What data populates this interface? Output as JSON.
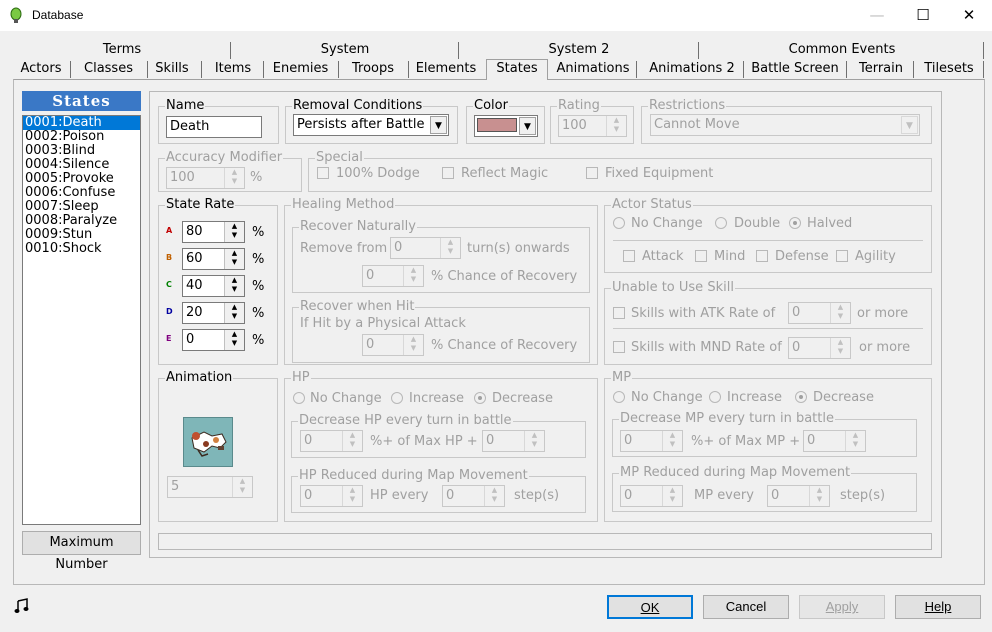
{
  "window": {
    "title": "Database",
    "minimize": "—",
    "maximize": "☐",
    "close": "✕"
  },
  "tabs": {
    "row1": [
      "Terms",
      "System",
      "System 2",
      "Common Events"
    ],
    "row2": [
      "Actors",
      "Classes",
      "Skills",
      "Items",
      "Enemies",
      "Troops",
      "Elements",
      "States",
      "Animations",
      "Animations 2",
      "Battle Screen",
      "Terrain",
      "Tilesets"
    ],
    "selected": "States"
  },
  "list": {
    "header": "States",
    "items": [
      "0001:Death",
      "0002:Poison",
      "0003:Blind",
      "0004:Silence",
      "0005:Provoke",
      "0006:Confuse",
      "0007:Sleep",
      "0008:Paralyze",
      "0009:Stun",
      "0010:Shock"
    ],
    "selected_index": 0,
    "max_button": "Maximum Number"
  },
  "name": {
    "label": "Name",
    "value": "Death"
  },
  "removal": {
    "label": "Removal Conditions",
    "value": "Persists after Battle"
  },
  "color": {
    "label": "Color",
    "swatch": "#c89090"
  },
  "rating": {
    "label": "Rating",
    "value": "100"
  },
  "restrictions": {
    "label": "Restrictions",
    "value": "Cannot Move"
  },
  "accuracy": {
    "label": "Accuracy Modifier",
    "value": "100",
    "unit": "%"
  },
  "special": {
    "label": "Special",
    "dodge": "100% Dodge",
    "reflect": "Reflect Magic",
    "fixed": "Fixed Equipment"
  },
  "state_rate": {
    "label": "State Rate",
    "rows": [
      {
        "letter": "A",
        "value": "80",
        "unit": "%",
        "color": "#c00000"
      },
      {
        "letter": "B",
        "value": "60",
        "unit": "%",
        "color": "#c06000"
      },
      {
        "letter": "C",
        "value": "40",
        "unit": "%",
        "color": "#008000"
      },
      {
        "letter": "D",
        "value": "20",
        "unit": "%",
        "color": "#0000a0"
      },
      {
        "letter": "E",
        "value": "0",
        "unit": "%",
        "color": "#800080"
      }
    ]
  },
  "healing": {
    "label": "Healing Method",
    "recover_naturally": {
      "label": "Recover Naturally",
      "remove_from": "Remove from",
      "turns_value": "0",
      "turns_suffix": "turn(s) onwards",
      "chance_value": "0",
      "chance_suffix": "% Chance of Recovery"
    },
    "recover_hit": {
      "label": "Recover when Hit",
      "desc": "If Hit by a Physical Attack",
      "chance_value": "0",
      "chance_suffix": "% Chance of Recovery"
    }
  },
  "actor_status": {
    "label": "Actor Status",
    "radios": [
      "No Change",
      "Double",
      "Halved"
    ],
    "selected": "Halved",
    "checks": [
      "Attack",
      "Mind",
      "Defense",
      "Agility"
    ]
  },
  "unable_skill": {
    "label": "Unable to Use Skill",
    "atk_label": "Skills with ATK Rate of",
    "atk_value": "0",
    "atk_suffix": "or more",
    "mnd_label": "Skills with MND Rate of",
    "mnd_value": "0",
    "mnd_suffix": "or more"
  },
  "animation": {
    "label": "Animation",
    "value": "5"
  },
  "hp": {
    "label": "HP",
    "radios": [
      "No Change",
      "Increase",
      "Decrease"
    ],
    "selected": "Decrease",
    "battle": {
      "label": "Decrease HP every turn in battle",
      "pct_value": "0",
      "pct_label": "%+ of Max HP +",
      "abs_value": "0"
    },
    "map": {
      "label": "HP Reduced during Map Movement",
      "amount": "0",
      "every": "HP every",
      "steps": "0",
      "steps_label": "step(s)"
    }
  },
  "mp": {
    "label": "MP",
    "radios": [
      "No Change",
      "Increase",
      "Decrease"
    ],
    "selected": "Decrease",
    "battle": {
      "label": "Decrease MP every turn in battle",
      "pct_value": "0",
      "pct_label": "%+ of Max MP +",
      "abs_value": "0"
    },
    "map": {
      "label": "MP Reduced during Map Movement",
      "amount": "0",
      "every": "MP every",
      "steps": "0",
      "steps_label": "step(s)"
    }
  },
  "footer": {
    "ok": "OK",
    "cancel": "Cancel",
    "apply": "Apply",
    "help": "Help",
    "music_icon": "music-note-icon"
  }
}
